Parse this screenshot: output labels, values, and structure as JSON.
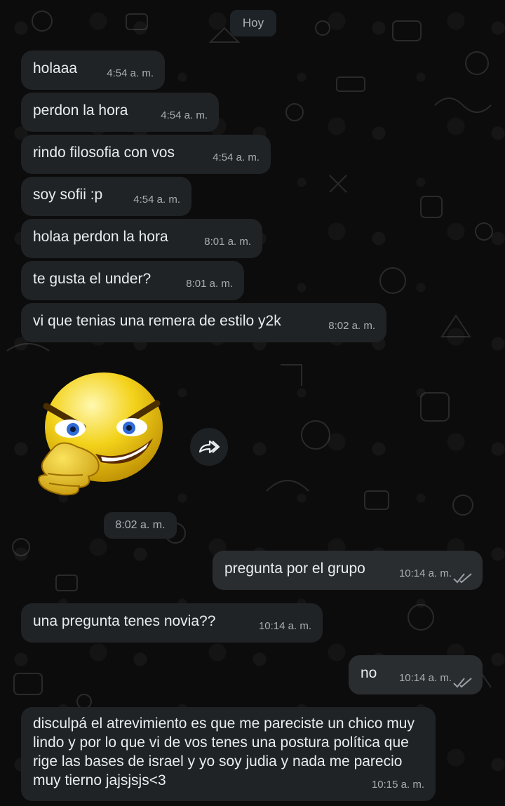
{
  "date_chip": "Hoy",
  "messages": [
    {
      "text": "holaaa",
      "time": "4:54 a. m."
    },
    {
      "text": "perdon la hora",
      "time": "4:54 a. m."
    },
    {
      "text": "rindo filosofia con vos",
      "time": "4:54 a. m."
    },
    {
      "text": "soy sofii :p",
      "time": "4:54 a. m."
    },
    {
      "text": "holaa perdon la hora",
      "time": "8:01 a. m."
    },
    {
      "text": "te gusta el under?",
      "time": "8:01 a. m."
    },
    {
      "text": "vi que tenias una remera de estilo y2k",
      "time": "8:02 a. m."
    },
    {
      "sticker": "evil-smirk-emoji-sticker",
      "time": "8:02 a. m."
    },
    {
      "text": "pregunta por el grupo",
      "time": "10:14 a. m.",
      "status": "read-double-check"
    },
    {
      "text": "una pregunta tenes novia??",
      "time": "10:14 a. m."
    },
    {
      "text": "no",
      "time": "10:14 a. m.",
      "status": "read-double-check"
    },
    {
      "text": "disculpá el atrevimiento es que me pareciste un chico muy lindo y por lo que vi de vos tenes una postura política que rige las bases de israel y yo soy judia y nada me parecio muy tierno jajsjsjs<3",
      "time": "10:15 a. m."
    }
  ],
  "icons": {
    "forward": "forward-icon",
    "ticks": "double-check-icon"
  },
  "colors": {
    "incoming_bubble": "#202325",
    "outgoing_bubble": "#2a2d2f",
    "background": "#0c0c0c",
    "ticks": "#9aa0a6"
  }
}
